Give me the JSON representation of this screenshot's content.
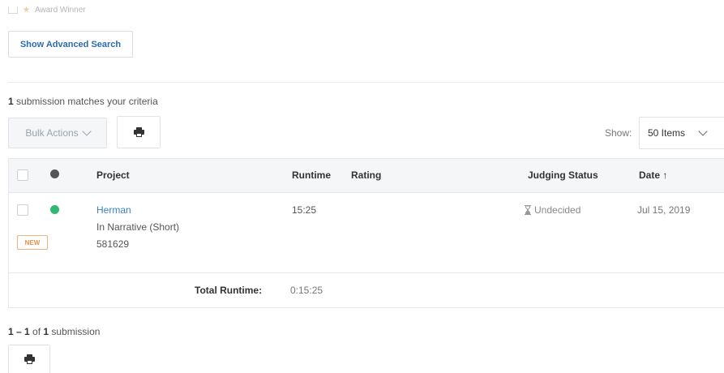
{
  "filters": {
    "partial_label": "Award Winner"
  },
  "advanced_search": {
    "label": "Show Advanced Search"
  },
  "results": {
    "count": "1",
    "summary": " submission matches your criteria"
  },
  "toolbar": {
    "bulk_actions": "Bulk Actions",
    "show_label": "Show:",
    "show_value": "50 Items"
  },
  "table": {
    "headers": {
      "project": "Project",
      "runtime": "Runtime",
      "rating": "Rating",
      "judging_status": "Judging Status",
      "date": "Date ↑"
    },
    "rows": [
      {
        "title": "Herman",
        "category": "In Narrative (Short)",
        "id": "581629",
        "badge": "NEW",
        "runtime": "15:25",
        "rating": "",
        "judging_status": "Undecided",
        "date": "Jul 15, 2019",
        "status_color": "#2eb872"
      }
    ],
    "footer": {
      "total_label": "Total Runtime:",
      "total_value": "0:15:25"
    }
  },
  "pagination": {
    "range": "1 – 1",
    "of": " of ",
    "total": "1",
    "unit": " submission"
  },
  "colors": {
    "accent": "#3b82c4",
    "header_dot": "#555555",
    "badge": "#e8904a"
  }
}
